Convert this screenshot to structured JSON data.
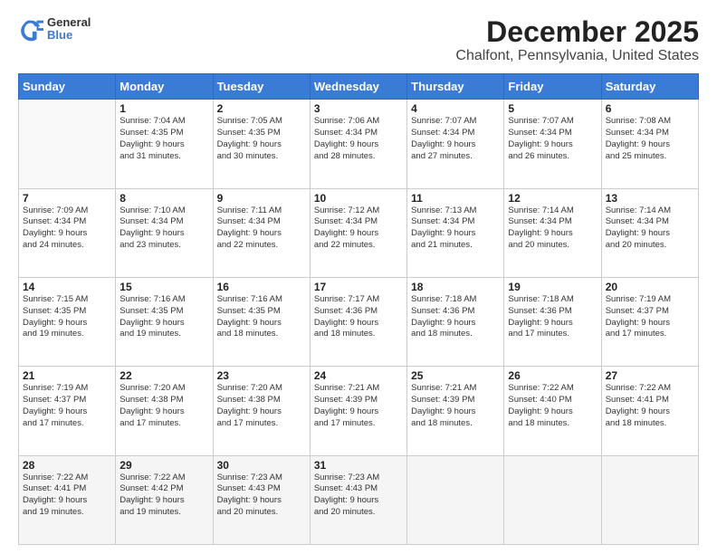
{
  "header": {
    "logo": {
      "general": "General",
      "blue": "Blue"
    },
    "title": "December 2025",
    "subtitle": "Chalfont, Pennsylvania, United States"
  },
  "calendar": {
    "days_of_week": [
      "Sunday",
      "Monday",
      "Tuesday",
      "Wednesday",
      "Thursday",
      "Friday",
      "Saturday"
    ],
    "weeks": [
      [
        {
          "day": "",
          "info": ""
        },
        {
          "day": "1",
          "info": "Sunrise: 7:04 AM\nSunset: 4:35 PM\nDaylight: 9 hours\nand 31 minutes."
        },
        {
          "day": "2",
          "info": "Sunrise: 7:05 AM\nSunset: 4:35 PM\nDaylight: 9 hours\nand 30 minutes."
        },
        {
          "day": "3",
          "info": "Sunrise: 7:06 AM\nSunset: 4:34 PM\nDaylight: 9 hours\nand 28 minutes."
        },
        {
          "day": "4",
          "info": "Sunrise: 7:07 AM\nSunset: 4:34 PM\nDaylight: 9 hours\nand 27 minutes."
        },
        {
          "day": "5",
          "info": "Sunrise: 7:07 AM\nSunset: 4:34 PM\nDaylight: 9 hours\nand 26 minutes."
        },
        {
          "day": "6",
          "info": "Sunrise: 7:08 AM\nSunset: 4:34 PM\nDaylight: 9 hours\nand 25 minutes."
        }
      ],
      [
        {
          "day": "7",
          "info": "Sunrise: 7:09 AM\nSunset: 4:34 PM\nDaylight: 9 hours\nand 24 minutes."
        },
        {
          "day": "8",
          "info": "Sunrise: 7:10 AM\nSunset: 4:34 PM\nDaylight: 9 hours\nand 23 minutes."
        },
        {
          "day": "9",
          "info": "Sunrise: 7:11 AM\nSunset: 4:34 PM\nDaylight: 9 hours\nand 22 minutes."
        },
        {
          "day": "10",
          "info": "Sunrise: 7:12 AM\nSunset: 4:34 PM\nDaylight: 9 hours\nand 22 minutes."
        },
        {
          "day": "11",
          "info": "Sunrise: 7:13 AM\nSunset: 4:34 PM\nDaylight: 9 hours\nand 21 minutes."
        },
        {
          "day": "12",
          "info": "Sunrise: 7:14 AM\nSunset: 4:34 PM\nDaylight: 9 hours\nand 20 minutes."
        },
        {
          "day": "13",
          "info": "Sunrise: 7:14 AM\nSunset: 4:34 PM\nDaylight: 9 hours\nand 20 minutes."
        }
      ],
      [
        {
          "day": "14",
          "info": "Sunrise: 7:15 AM\nSunset: 4:35 PM\nDaylight: 9 hours\nand 19 minutes."
        },
        {
          "day": "15",
          "info": "Sunrise: 7:16 AM\nSunset: 4:35 PM\nDaylight: 9 hours\nand 19 minutes."
        },
        {
          "day": "16",
          "info": "Sunrise: 7:16 AM\nSunset: 4:35 PM\nDaylight: 9 hours\nand 18 minutes."
        },
        {
          "day": "17",
          "info": "Sunrise: 7:17 AM\nSunset: 4:36 PM\nDaylight: 9 hours\nand 18 minutes."
        },
        {
          "day": "18",
          "info": "Sunrise: 7:18 AM\nSunset: 4:36 PM\nDaylight: 9 hours\nand 18 minutes."
        },
        {
          "day": "19",
          "info": "Sunrise: 7:18 AM\nSunset: 4:36 PM\nDaylight: 9 hours\nand 17 minutes."
        },
        {
          "day": "20",
          "info": "Sunrise: 7:19 AM\nSunset: 4:37 PM\nDaylight: 9 hours\nand 17 minutes."
        }
      ],
      [
        {
          "day": "21",
          "info": "Sunrise: 7:19 AM\nSunset: 4:37 PM\nDaylight: 9 hours\nand 17 minutes."
        },
        {
          "day": "22",
          "info": "Sunrise: 7:20 AM\nSunset: 4:38 PM\nDaylight: 9 hours\nand 17 minutes."
        },
        {
          "day": "23",
          "info": "Sunrise: 7:20 AM\nSunset: 4:38 PM\nDaylight: 9 hours\nand 17 minutes."
        },
        {
          "day": "24",
          "info": "Sunrise: 7:21 AM\nSunset: 4:39 PM\nDaylight: 9 hours\nand 17 minutes."
        },
        {
          "day": "25",
          "info": "Sunrise: 7:21 AM\nSunset: 4:39 PM\nDaylight: 9 hours\nand 18 minutes."
        },
        {
          "day": "26",
          "info": "Sunrise: 7:22 AM\nSunset: 4:40 PM\nDaylight: 9 hours\nand 18 minutes."
        },
        {
          "day": "27",
          "info": "Sunrise: 7:22 AM\nSunset: 4:41 PM\nDaylight: 9 hours\nand 18 minutes."
        }
      ],
      [
        {
          "day": "28",
          "info": "Sunrise: 7:22 AM\nSunset: 4:41 PM\nDaylight: 9 hours\nand 19 minutes."
        },
        {
          "day": "29",
          "info": "Sunrise: 7:22 AM\nSunset: 4:42 PM\nDaylight: 9 hours\nand 19 minutes."
        },
        {
          "day": "30",
          "info": "Sunrise: 7:23 AM\nSunset: 4:43 PM\nDaylight: 9 hours\nand 20 minutes."
        },
        {
          "day": "31",
          "info": "Sunrise: 7:23 AM\nSunset: 4:43 PM\nDaylight: 9 hours\nand 20 minutes."
        },
        {
          "day": "",
          "info": ""
        },
        {
          "day": "",
          "info": ""
        },
        {
          "day": "",
          "info": ""
        }
      ]
    ]
  }
}
